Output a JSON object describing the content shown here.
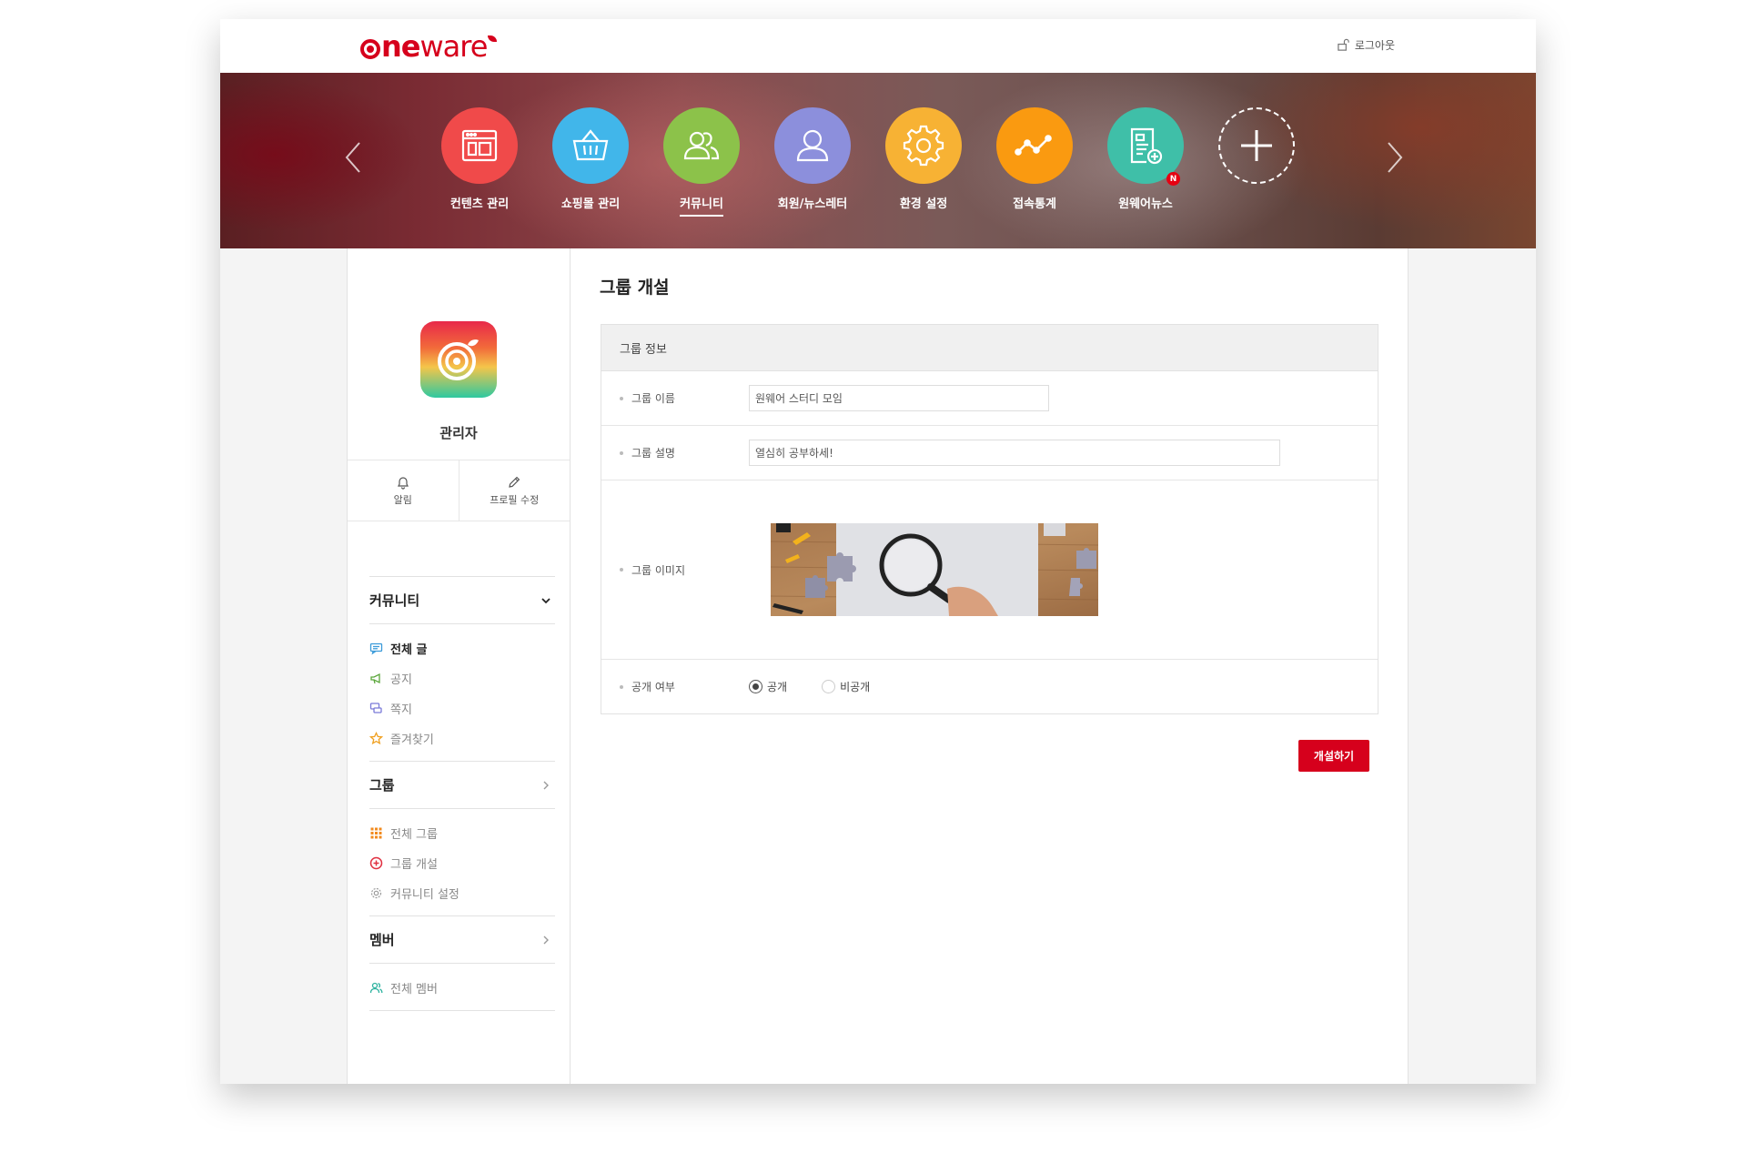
{
  "brand": {
    "logo_ne": "ne",
    "logo_ware": "ware",
    "accent_color": "#d6001c"
  },
  "header": {
    "logout_label": "로그아웃",
    "logout_icon": "unlock-icon"
  },
  "banner": {
    "prev_icon": "chevron-left-icon",
    "next_icon": "chevron-right-icon",
    "items": [
      {
        "label": "컨텐츠 관리",
        "icon": "layout-icon",
        "color": "#f04a4a",
        "active": false
      },
      {
        "label": "쇼핑몰 관리",
        "icon": "basket-icon",
        "color": "#41b6ea",
        "active": false
      },
      {
        "label": "커뮤니티",
        "icon": "users-icon",
        "color": "#8cc24a",
        "active": true
      },
      {
        "label": "회원/뉴스레터",
        "icon": "user-icon",
        "color": "#8c8fdc",
        "active": false
      },
      {
        "label": "환경 설정",
        "icon": "gear-icon",
        "color": "#f7b234",
        "active": false
      },
      {
        "label": "접속통계",
        "icon": "trend-line-icon",
        "color": "#fa9a10",
        "active": false
      },
      {
        "label": "원웨어뉴스",
        "icon": "news-add-icon",
        "color": "#3fbfa8",
        "active": false,
        "badge": "N"
      },
      {
        "label": "",
        "icon": "plus-icon",
        "color": "transparent",
        "active": false
      }
    ]
  },
  "sidebar": {
    "profile_name": "관리자",
    "actions": [
      {
        "label": "알림",
        "icon": "bell-icon"
      },
      {
        "label": "프로필 수정",
        "icon": "pencil-icon"
      }
    ],
    "sections": [
      {
        "title": "커뮤니티",
        "expanded": true,
        "items": [
          {
            "label": "전체 글",
            "icon": "chat-icon",
            "active": true
          },
          {
            "label": "공지",
            "icon": "megaphone-icon",
            "active": false
          },
          {
            "label": "쪽지",
            "icon": "message-icon",
            "active": false
          },
          {
            "label": "즐겨찾기",
            "icon": "star-icon",
            "active": false
          }
        ]
      },
      {
        "title": "그룹",
        "expanded": false,
        "items": [
          {
            "label": "전체 그룹",
            "icon": "grid-icon",
            "active": false
          },
          {
            "label": "그룹 개설",
            "icon": "plus-circle-icon",
            "active": false
          },
          {
            "label": "커뮤니티 설정",
            "icon": "gear-icon",
            "active": false
          }
        ]
      },
      {
        "title": "멤버",
        "expanded": false,
        "items": [
          {
            "label": "전체 멤버",
            "icon": "members-icon",
            "active": false
          }
        ]
      }
    ]
  },
  "main": {
    "page_title": "그룹 개설",
    "form": {
      "header": "그룹 정보",
      "name_label": "그룹 이름",
      "name_value": "원웨어 스터디 모임",
      "desc_label": "그룹 설명",
      "desc_value": "열심히 공부하세!",
      "image_label": "그룹 이미지",
      "visibility_label": "공개 여부",
      "visibility_options": [
        "공개",
        "비공개"
      ],
      "visibility_selected": "공개"
    },
    "submit_label": "개설하기"
  }
}
